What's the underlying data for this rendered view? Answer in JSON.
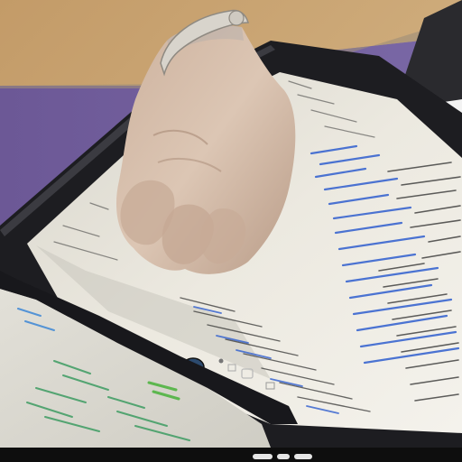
{
  "scene": {
    "title": "",
    "colors": {
      "wall": "#c9a679",
      "tablecloth": "#6f5a9a",
      "bezel": "#1e1e22",
      "screen": "#e9e6dc",
      "code_blue": "#2f5ecf",
      "code_dark": "#2b2b2b",
      "skin": "#d9c2b0",
      "bar": "#0e0e0e"
    },
    "icons": [
      "home-button-icon",
      "bracelet",
      "hand"
    ]
  }
}
